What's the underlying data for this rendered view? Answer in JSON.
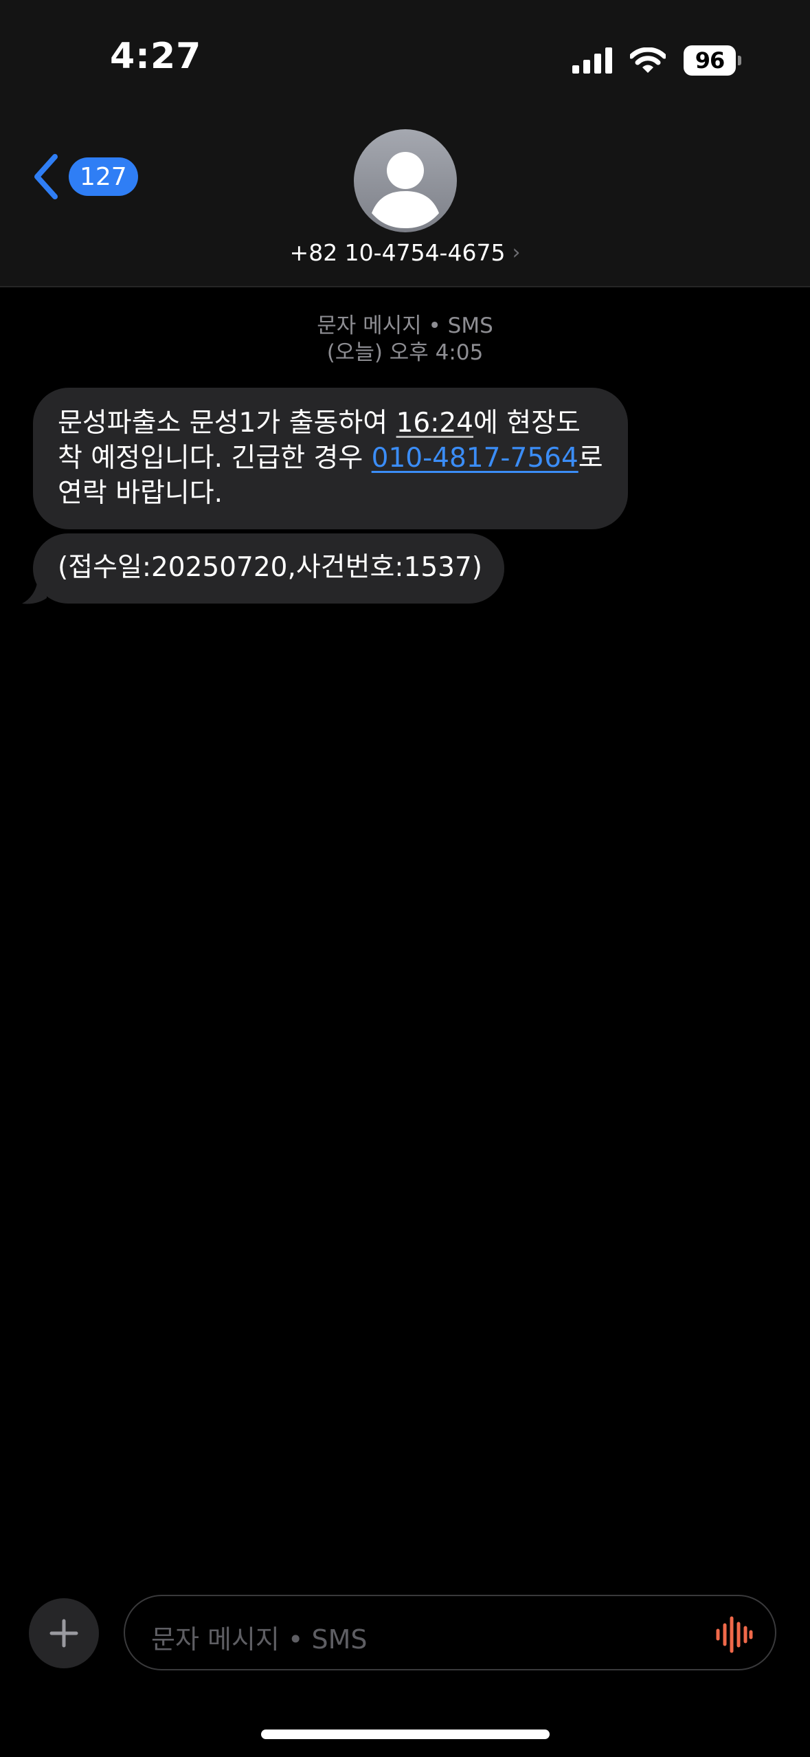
{
  "status_bar": {
    "time": "4:27",
    "battery": "96",
    "signal_icon": "cellular-signal-icon",
    "wifi_icon": "wifi-icon"
  },
  "header": {
    "back_badge": "127",
    "contact_number": "+82 10-4754-4675",
    "contact_chevron": "›"
  },
  "conversation": {
    "meta_line1": "문자 메시지 • SMS",
    "meta_line2": "(오늘) 오후 4:05",
    "message1": {
      "part1": "문성파출소 문성1가 출동하여 ",
      "time_link": "16:24",
      "part2": "에 현장도착 예정입니다. 긴급한 경우 ",
      "phone_link": "010-4817-7564",
      "part3": "로 연락 바랍니다."
    },
    "message2": "(접수일:20250720,사건번호:1537)"
  },
  "compose": {
    "placeholder": "문자 메시지 • SMS"
  },
  "colors": {
    "accent_blue": "#2f7ef5",
    "link_blue": "#3b8df7",
    "bubble_gray": "#262628",
    "audio_orange": "#f0694a"
  }
}
